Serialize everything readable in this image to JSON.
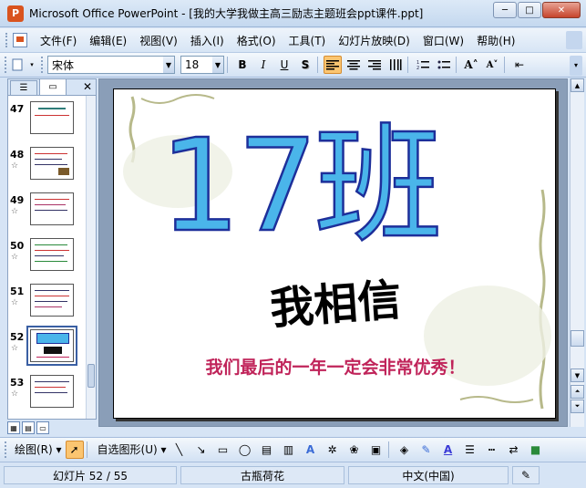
{
  "window": {
    "title": "Microsoft Office PowerPoint - [我的大学我做主高三励志主题班会ppt课件.ppt]",
    "app_icon": "P",
    "minimize": "─",
    "maximize": "□",
    "close": "✕"
  },
  "menu": {
    "items": [
      "文件(F)",
      "编辑(E)",
      "视图(V)",
      "插入(I)",
      "格式(O)",
      "工具(T)",
      "幻灯片放映(D)",
      "窗口(W)",
      "帮助(H)"
    ]
  },
  "format_toolbar": {
    "font_name": "宋体",
    "font_size": "18",
    "bold": "B",
    "italic": "I",
    "underline": "U",
    "shadow": "S",
    "align_left": "≡",
    "align_center": "≡",
    "align_right": "≡",
    "distribute": "⫼",
    "numbering": "⋮≡",
    "bullets": "⋮≡",
    "grow_font": "A˄",
    "shrink_font": "A˅",
    "decrease_indent": "⇤"
  },
  "left_panel": {
    "outline_tab": "☰",
    "slides_tab": "▭",
    "close": "✕",
    "thumbnails": [
      {
        "num": "47",
        "star": "",
        "selected": false
      },
      {
        "num": "48",
        "star": "☆",
        "selected": false
      },
      {
        "num": "49",
        "star": "☆",
        "selected": false
      },
      {
        "num": "50",
        "star": "☆",
        "selected": false
      },
      {
        "num": "51",
        "star": "☆",
        "selected": false
      },
      {
        "num": "52",
        "star": "☆",
        "selected": true
      },
      {
        "num": "53",
        "star": "☆",
        "selected": false
      }
    ]
  },
  "slide": {
    "title": "17班",
    "subtitle": "我相信",
    "tagline": "我们最后的一年一定会非常优秀！",
    "colors": {
      "title_fill": "#4ab5ea",
      "title_stroke": "#1d2f9a",
      "tagline": "#c0245a"
    }
  },
  "draw_toolbar": {
    "draw_menu": "绘图(R) ▾",
    "autoshapes_menu": "自选图形(U) ▾",
    "icons": [
      "pointer-icon",
      "line-icon",
      "arrow-icon",
      "rectangle-icon",
      "oval-icon",
      "textbox-icon",
      "vertical-textbox-icon",
      "wordart-icon",
      "diagram-icon",
      "clipart-icon",
      "picture-icon",
      "fill-color-icon",
      "line-color-icon",
      "font-color-icon",
      "line-style-icon",
      "dash-style-icon",
      "arrow-style-icon",
      "shadow-icon"
    ]
  },
  "status": {
    "slide_pos": "幻灯片 52 / 55",
    "design": "古瓶荷花",
    "language": "中文(中国)"
  }
}
